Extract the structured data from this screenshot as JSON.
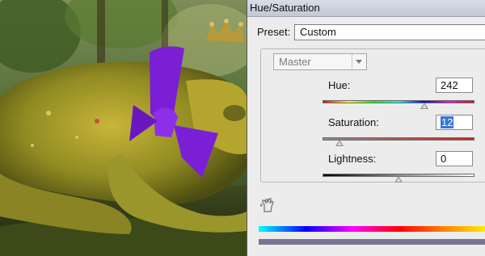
{
  "dialog": {
    "title": "Hue/Saturation",
    "preset": {
      "label": "Preset:",
      "value": "Custom"
    },
    "channel": {
      "value": "Master"
    },
    "hue": {
      "label": "Hue:",
      "value": "242",
      "position": 0.67
    },
    "saturation": {
      "label": "Saturation:",
      "value": "12",
      "position": 0.11
    },
    "lightness": {
      "label": "Lightness:",
      "value": "0",
      "position": 0.5
    },
    "colors": {
      "dialog_bg": "#ececec",
      "selection": "#3875d7",
      "bow": "#7a1fd6"
    }
  },
  "icons": [
    "hand-adjust-icon",
    "crown-icon"
  ]
}
